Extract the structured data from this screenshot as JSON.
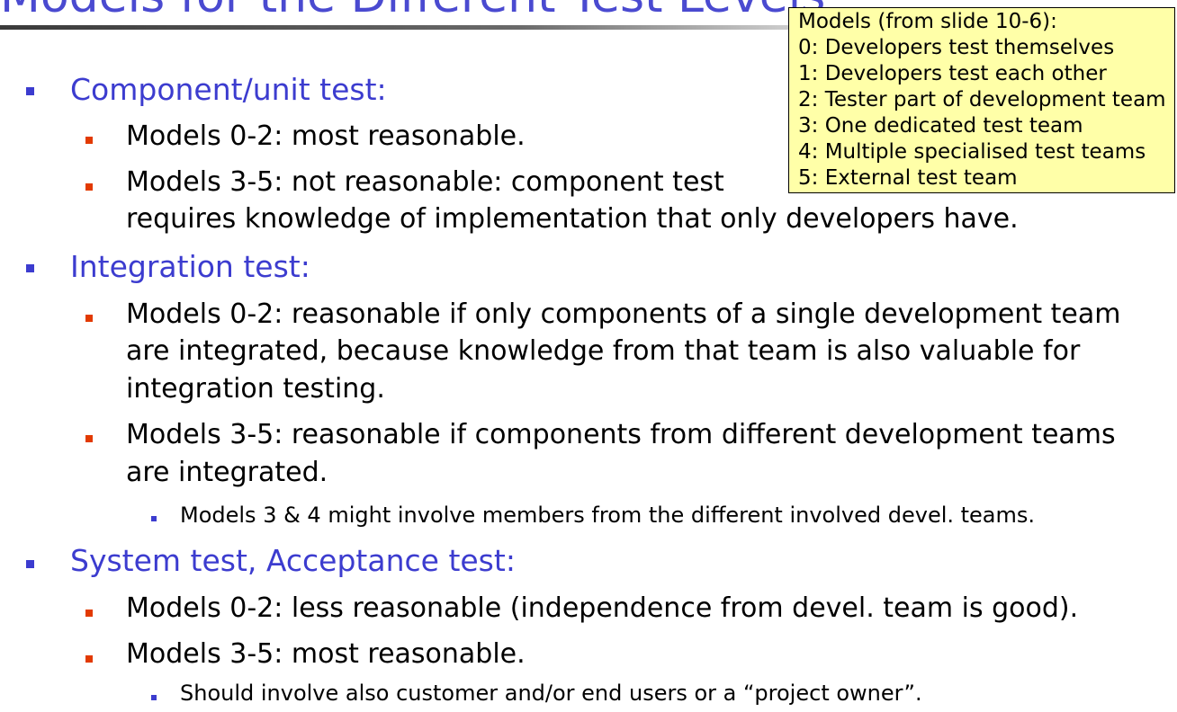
{
  "title": "Models for the Different Test Levels",
  "callout": {
    "heading": "Models (from slide 10-6):",
    "items": [
      "0: Developers test themselves",
      "1: Developers test each other",
      "2: Tester part of development team",
      "3: One dedicated test team",
      "4: Multiple specialised test teams",
      "5: External test team"
    ]
  },
  "sections": [
    {
      "heading": "Component/unit test:",
      "points": [
        "Models 0-2: most reasonable.",
        "Models 3-5: not reasonable: component test",
        "requires knowledge of implementation that only developers have."
      ]
    },
    {
      "heading": "Integration test:",
      "points": [
        "Models 0-2: reasonable if only components of a single development team",
        "are integrated, because knowledge from that team is also valuable for",
        "integration testing.",
        "Models 3-5: reasonable if components from different development teams",
        "are integrated."
      ],
      "subpoint": "Models 3 & 4 might involve members from the different involved devel. teams."
    },
    {
      "heading": "System test, Acceptance test:",
      "points": [
        "Models 0-2: less reasonable (independence from devel. team is good).",
        "Models 3-5: most reasonable."
      ],
      "subpoint": "Should involve also customer and/or end users or a “project owner”."
    }
  ]
}
